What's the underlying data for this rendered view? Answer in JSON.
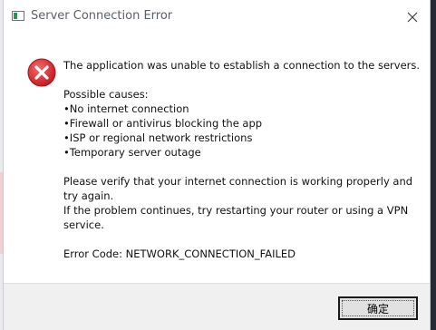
{
  "window": {
    "title": "Server Connection Error",
    "close_icon": "close-icon"
  },
  "message": {
    "icon": "error-icon",
    "headline": "The application was unable to establish a connection to the servers.",
    "causes_title": "Possible causes:",
    "causes": [
      "No internet connection",
      "Firewall or antivirus blocking the app",
      "ISP or regional network restrictions",
      "Temporary server outage"
    ],
    "verify_text": "Please verify that your internet connection is working properly and try again.",
    "restart_text": "If the problem continues, try restarting your router or using a VPN service.",
    "error_code": "Error Code: NETWORK_CONNECTION_FAILED"
  },
  "footer": {
    "ok_label": "确定"
  },
  "colors": {
    "error_red": "#d8262f",
    "button_bg": "#e1e1e1",
    "footer_bg": "#f0f0f0"
  }
}
